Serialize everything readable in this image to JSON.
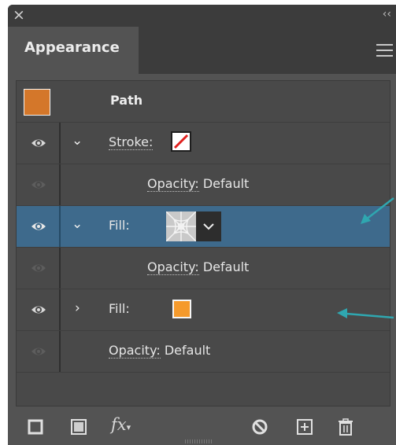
{
  "window": {
    "close_icon": "close-icon",
    "collapse_glyph": "‹‹"
  },
  "tab": {
    "title": "Appearance",
    "menu_icon": "hamburger-menu-icon"
  },
  "rows": [
    {
      "label": "Path",
      "kind": "object-header",
      "swatch_color": "#d4772a"
    },
    {
      "label": "Stroke:",
      "kind": "stroke",
      "visible": true,
      "expanded": true,
      "swatch": "none-stroke"
    },
    {
      "label": "Opacity:",
      "value": "Default",
      "kind": "opacity",
      "visible": false
    },
    {
      "label": "Fill:",
      "kind": "fill",
      "visible": true,
      "expanded": true,
      "selected": true,
      "swatch": "web-pattern"
    },
    {
      "label": "Opacity:",
      "value": "Default",
      "kind": "opacity",
      "visible": false
    },
    {
      "label": "Fill:",
      "kind": "fill",
      "visible": true,
      "expanded": false,
      "swatch_color": "#f59a2c"
    },
    {
      "label": "Opacity:",
      "value": "Default",
      "kind": "opacity",
      "visible": false
    }
  ],
  "footer": {
    "icons": [
      "add-new-stroke-icon",
      "add-new-fill-icon",
      "fx-effects-icon",
      "clear-appearance-icon",
      "duplicate-item-icon",
      "delete-icon"
    ],
    "fx_label": "fx"
  },
  "colors": {
    "panel_bg": "#535353",
    "selected_row": "#3e6a8c",
    "annotation_arrow": "#2fa7b0"
  }
}
